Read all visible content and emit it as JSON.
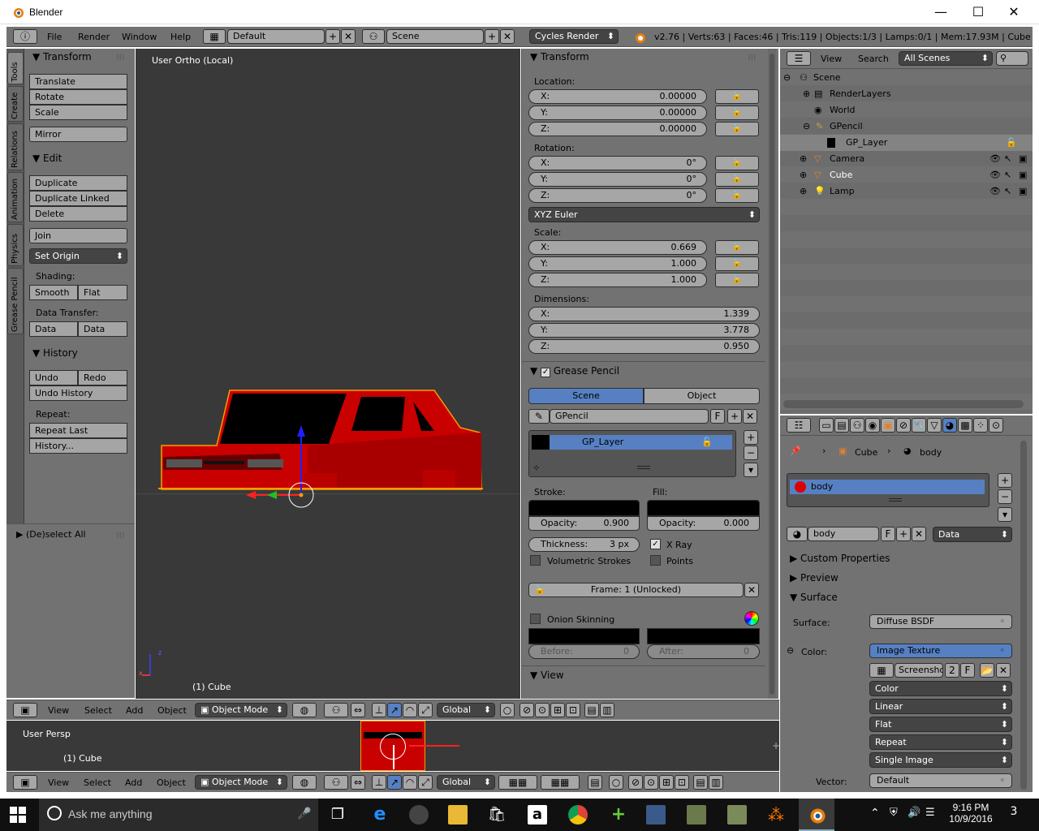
{
  "window": {
    "title": "Blender",
    "controls": {
      "minimize": "—",
      "maximize": "☐",
      "close": "✕"
    }
  },
  "infobar": {
    "menus": [
      "File",
      "Render",
      "Window",
      "Help"
    ],
    "layout": "Default",
    "scene": "Scene",
    "engine": "Cycles Render",
    "stats": "v2.76 | Verts:63 | Faces:46 | Tris:119 | Objects:1/3 | Lamps:0/1 | Mem:17.93M | Cube"
  },
  "toolshelf": {
    "tabs": [
      "Tools",
      "Create",
      "Relations",
      "Animation",
      "Physics",
      "Grease Pencil"
    ],
    "transform": {
      "header": "Transform",
      "buttons": [
        "Translate",
        "Rotate",
        "Scale",
        "Mirror"
      ]
    },
    "edit": {
      "header": "Edit",
      "buttons": [
        "Duplicate",
        "Duplicate Linked",
        "Delete",
        "Join"
      ],
      "set_origin": "Set Origin"
    },
    "shading": {
      "label": "Shading:",
      "smooth": "Smooth",
      "flat": "Flat"
    },
    "data_transfer": {
      "label": "Data Transfer:",
      "data": "Data",
      "data_layo": "Data Layo"
    },
    "history": {
      "header": "History",
      "undo": "Undo",
      "redo": "Redo",
      "undo_history": "Undo History"
    },
    "repeat": {
      "label": "Repeat:",
      "repeat_last": "Repeat Last",
      "history": "History..."
    },
    "operator": "(De)select All"
  },
  "viewport": {
    "view_label": "User Ortho (Local)",
    "object_label": "(1) Cube",
    "axes": {
      "x": "x",
      "y": "y",
      "z": "z"
    },
    "colors": {
      "background": "#393939",
      "car": "#c90000",
      "window": "#000000",
      "outline": "#ff9a00"
    }
  },
  "viewport_header": {
    "menus": [
      "View",
      "Select",
      "Add",
      "Object"
    ],
    "mode": "Object Mode",
    "orientation": "Global"
  },
  "timeline": {
    "view_label": "User Persp",
    "object_label": "(1) Cube",
    "menus": [
      "View",
      "Select",
      "Add",
      "Object"
    ],
    "mode": "Object Mode",
    "orientation": "Global"
  },
  "npanel": {
    "transform_header": "Transform",
    "location": {
      "label": "Location:",
      "x": "0.00000",
      "y": "0.00000",
      "z": "0.00000"
    },
    "rotation": {
      "label": "Rotation:",
      "x": "0°",
      "y": "0°",
      "z": "0°"
    },
    "rotation_mode": "XYZ Euler",
    "scale": {
      "label": "Scale:",
      "x": "0.669",
      "y": "1.000",
      "z": "1.000"
    },
    "dimensions": {
      "label": "Dimensions:",
      "x": "1.339",
      "y": "3.778",
      "z": "0.950"
    },
    "axis_labels": {
      "x": "X:",
      "y": "Y:",
      "z": "Z:"
    },
    "grease_pencil": {
      "header": "Grease Pencil",
      "tab_scene": "Scene",
      "tab_object": "Object",
      "datablock": "GPencil",
      "fake_user": "F",
      "layer": "GP_Layer",
      "stroke_label": "Stroke:",
      "fill_label": "Fill:",
      "stroke_opacity": "Opacity:",
      "stroke_opacity_value": "0.900",
      "fill_opacity": "Opacity:",
      "fill_opacity_value": "0.000",
      "thickness": "Thickness:",
      "thickness_value": "3 px",
      "xray": "X Ray",
      "volumetric": "Volumetric Strokes",
      "points": "Points",
      "frame": "Frame: 1 (Unlocked)",
      "onion": "Onion Skinning",
      "before": "Before:",
      "before_value": "0",
      "after": "After:",
      "after_value": "0"
    },
    "view_header": "View"
  },
  "outliner": {
    "menus": [
      "View",
      "Search"
    ],
    "filter": "All Scenes",
    "items": [
      {
        "label": "Scene"
      },
      {
        "label": "RenderLayers"
      },
      {
        "label": "World"
      },
      {
        "label": "GPencil"
      },
      {
        "label": "GP_Layer"
      },
      {
        "label": "Camera"
      },
      {
        "label": "Cube"
      },
      {
        "label": "Lamp"
      }
    ]
  },
  "properties": {
    "breadcrumb": {
      "object": "Cube",
      "material": "body"
    },
    "material_slot": "body",
    "material_name": "body",
    "fake_user": "F",
    "link": "Data",
    "panels": {
      "custom": "Custom Properties",
      "preview": "Preview",
      "surface": "Surface"
    },
    "surface": {
      "label": "Surface:",
      "value": "Diffuse BSDF"
    },
    "color": {
      "label": "Color:",
      "value": "Image Texture"
    },
    "image": {
      "name": "Screensho",
      "users": "2",
      "fake": "F"
    },
    "dropdowns": [
      "Color",
      "Linear",
      "Flat",
      "Repeat",
      "Single Image"
    ],
    "vector": {
      "label": "Vector:",
      "value": "Default"
    }
  },
  "taskbar": {
    "search": "Ask me anything",
    "time": "9:16 PM",
    "date": "10/9/2016",
    "notifications": "3"
  }
}
